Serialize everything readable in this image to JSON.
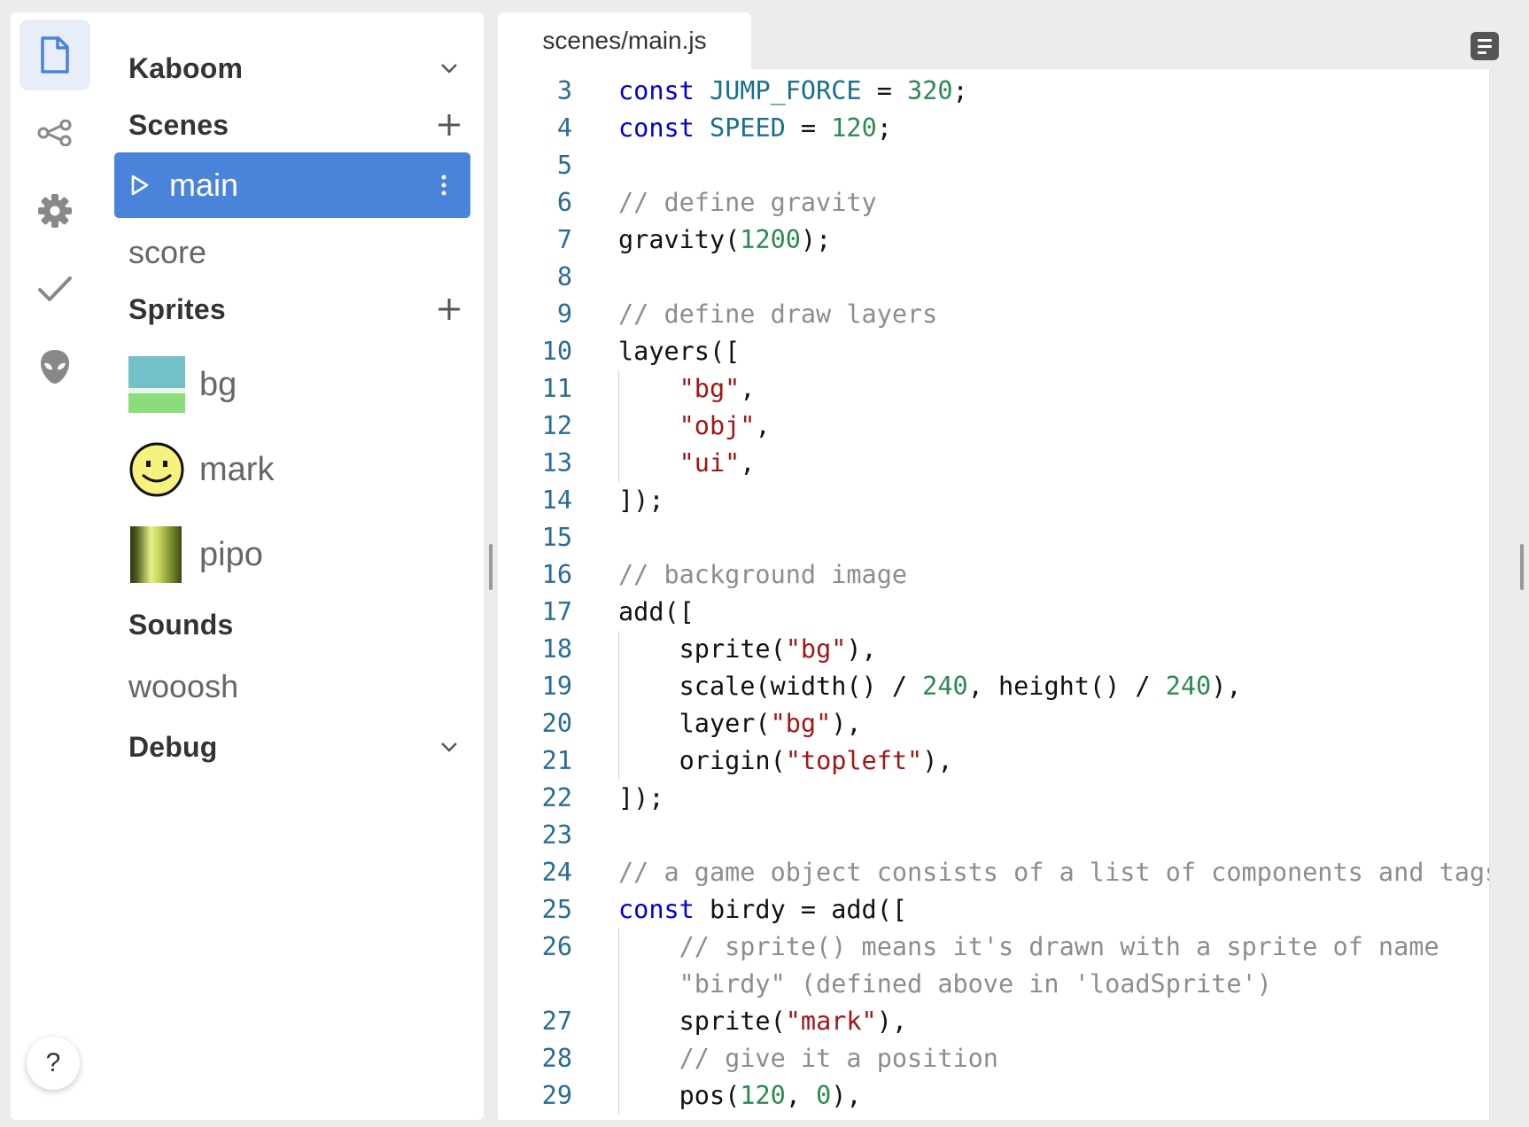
{
  "sidebar": {
    "rail": [
      {
        "name": "file-icon",
        "active": true
      },
      {
        "name": "share-nodes-icon",
        "active": false
      },
      {
        "name": "gear-icon",
        "active": false
      },
      {
        "name": "checkmark-icon",
        "active": false
      },
      {
        "name": "alien-icon",
        "active": false
      }
    ],
    "help_label": "?",
    "project": {
      "title": "Kaboom"
    },
    "scenes": {
      "title": "Scenes",
      "items": [
        "main",
        "score"
      ],
      "selected": "main"
    },
    "sprites": {
      "title": "Sprites",
      "items": [
        {
          "label": "bg",
          "thumb": "sky-grass-thumbnail"
        },
        {
          "label": "mark",
          "thumb": "smiley-face-thumbnail"
        },
        {
          "label": "pipo",
          "thumb": "green-pipe-thumbnail"
        }
      ]
    },
    "sounds": {
      "title": "Sounds",
      "items": [
        "wooosh"
      ]
    },
    "debug": {
      "title": "Debug"
    }
  },
  "editor": {
    "tab": "scenes/main.js",
    "lines": [
      {
        "n": "3",
        "text": "const JUMP_FORCE = 320;"
      },
      {
        "n": "4",
        "text": "const SPEED = 120;"
      },
      {
        "n": "5",
        "text": ""
      },
      {
        "n": "6",
        "text": "// define gravity"
      },
      {
        "n": "7",
        "text": "gravity(1200);"
      },
      {
        "n": "8",
        "text": ""
      },
      {
        "n": "9",
        "text": "// define draw layers"
      },
      {
        "n": "10",
        "text": "layers(["
      },
      {
        "n": "11",
        "text": "    \"bg\","
      },
      {
        "n": "12",
        "text": "    \"obj\","
      },
      {
        "n": "13",
        "text": "    \"ui\","
      },
      {
        "n": "14",
        "text": "]);"
      },
      {
        "n": "15",
        "text": ""
      },
      {
        "n": "16",
        "text": "// background image"
      },
      {
        "n": "17",
        "text": "add(["
      },
      {
        "n": "18",
        "text": "    sprite(\"bg\"),"
      },
      {
        "n": "19",
        "text": "    scale(width() / 240, height() / 240),"
      },
      {
        "n": "20",
        "text": "    layer(\"bg\"),"
      },
      {
        "n": "21",
        "text": "    origin(\"topleft\"),"
      },
      {
        "n": "22",
        "text": "]);"
      },
      {
        "n": "23",
        "text": ""
      },
      {
        "n": "24",
        "text": "// a game object consists of a list of components and tags"
      },
      {
        "n": "25",
        "text": "const birdy = add(["
      },
      {
        "n": "26",
        "text": "    // sprite() means it's drawn with a sprite of name"
      },
      {
        "n": "",
        "text": "    \"birdy\" (defined above in 'loadSprite')"
      },
      {
        "n": "27",
        "text": "    sprite(\"mark\"),"
      },
      {
        "n": "28",
        "text": "    // give it a position"
      },
      {
        "n": "29",
        "text": "    pos(120, 0),"
      }
    ]
  }
}
